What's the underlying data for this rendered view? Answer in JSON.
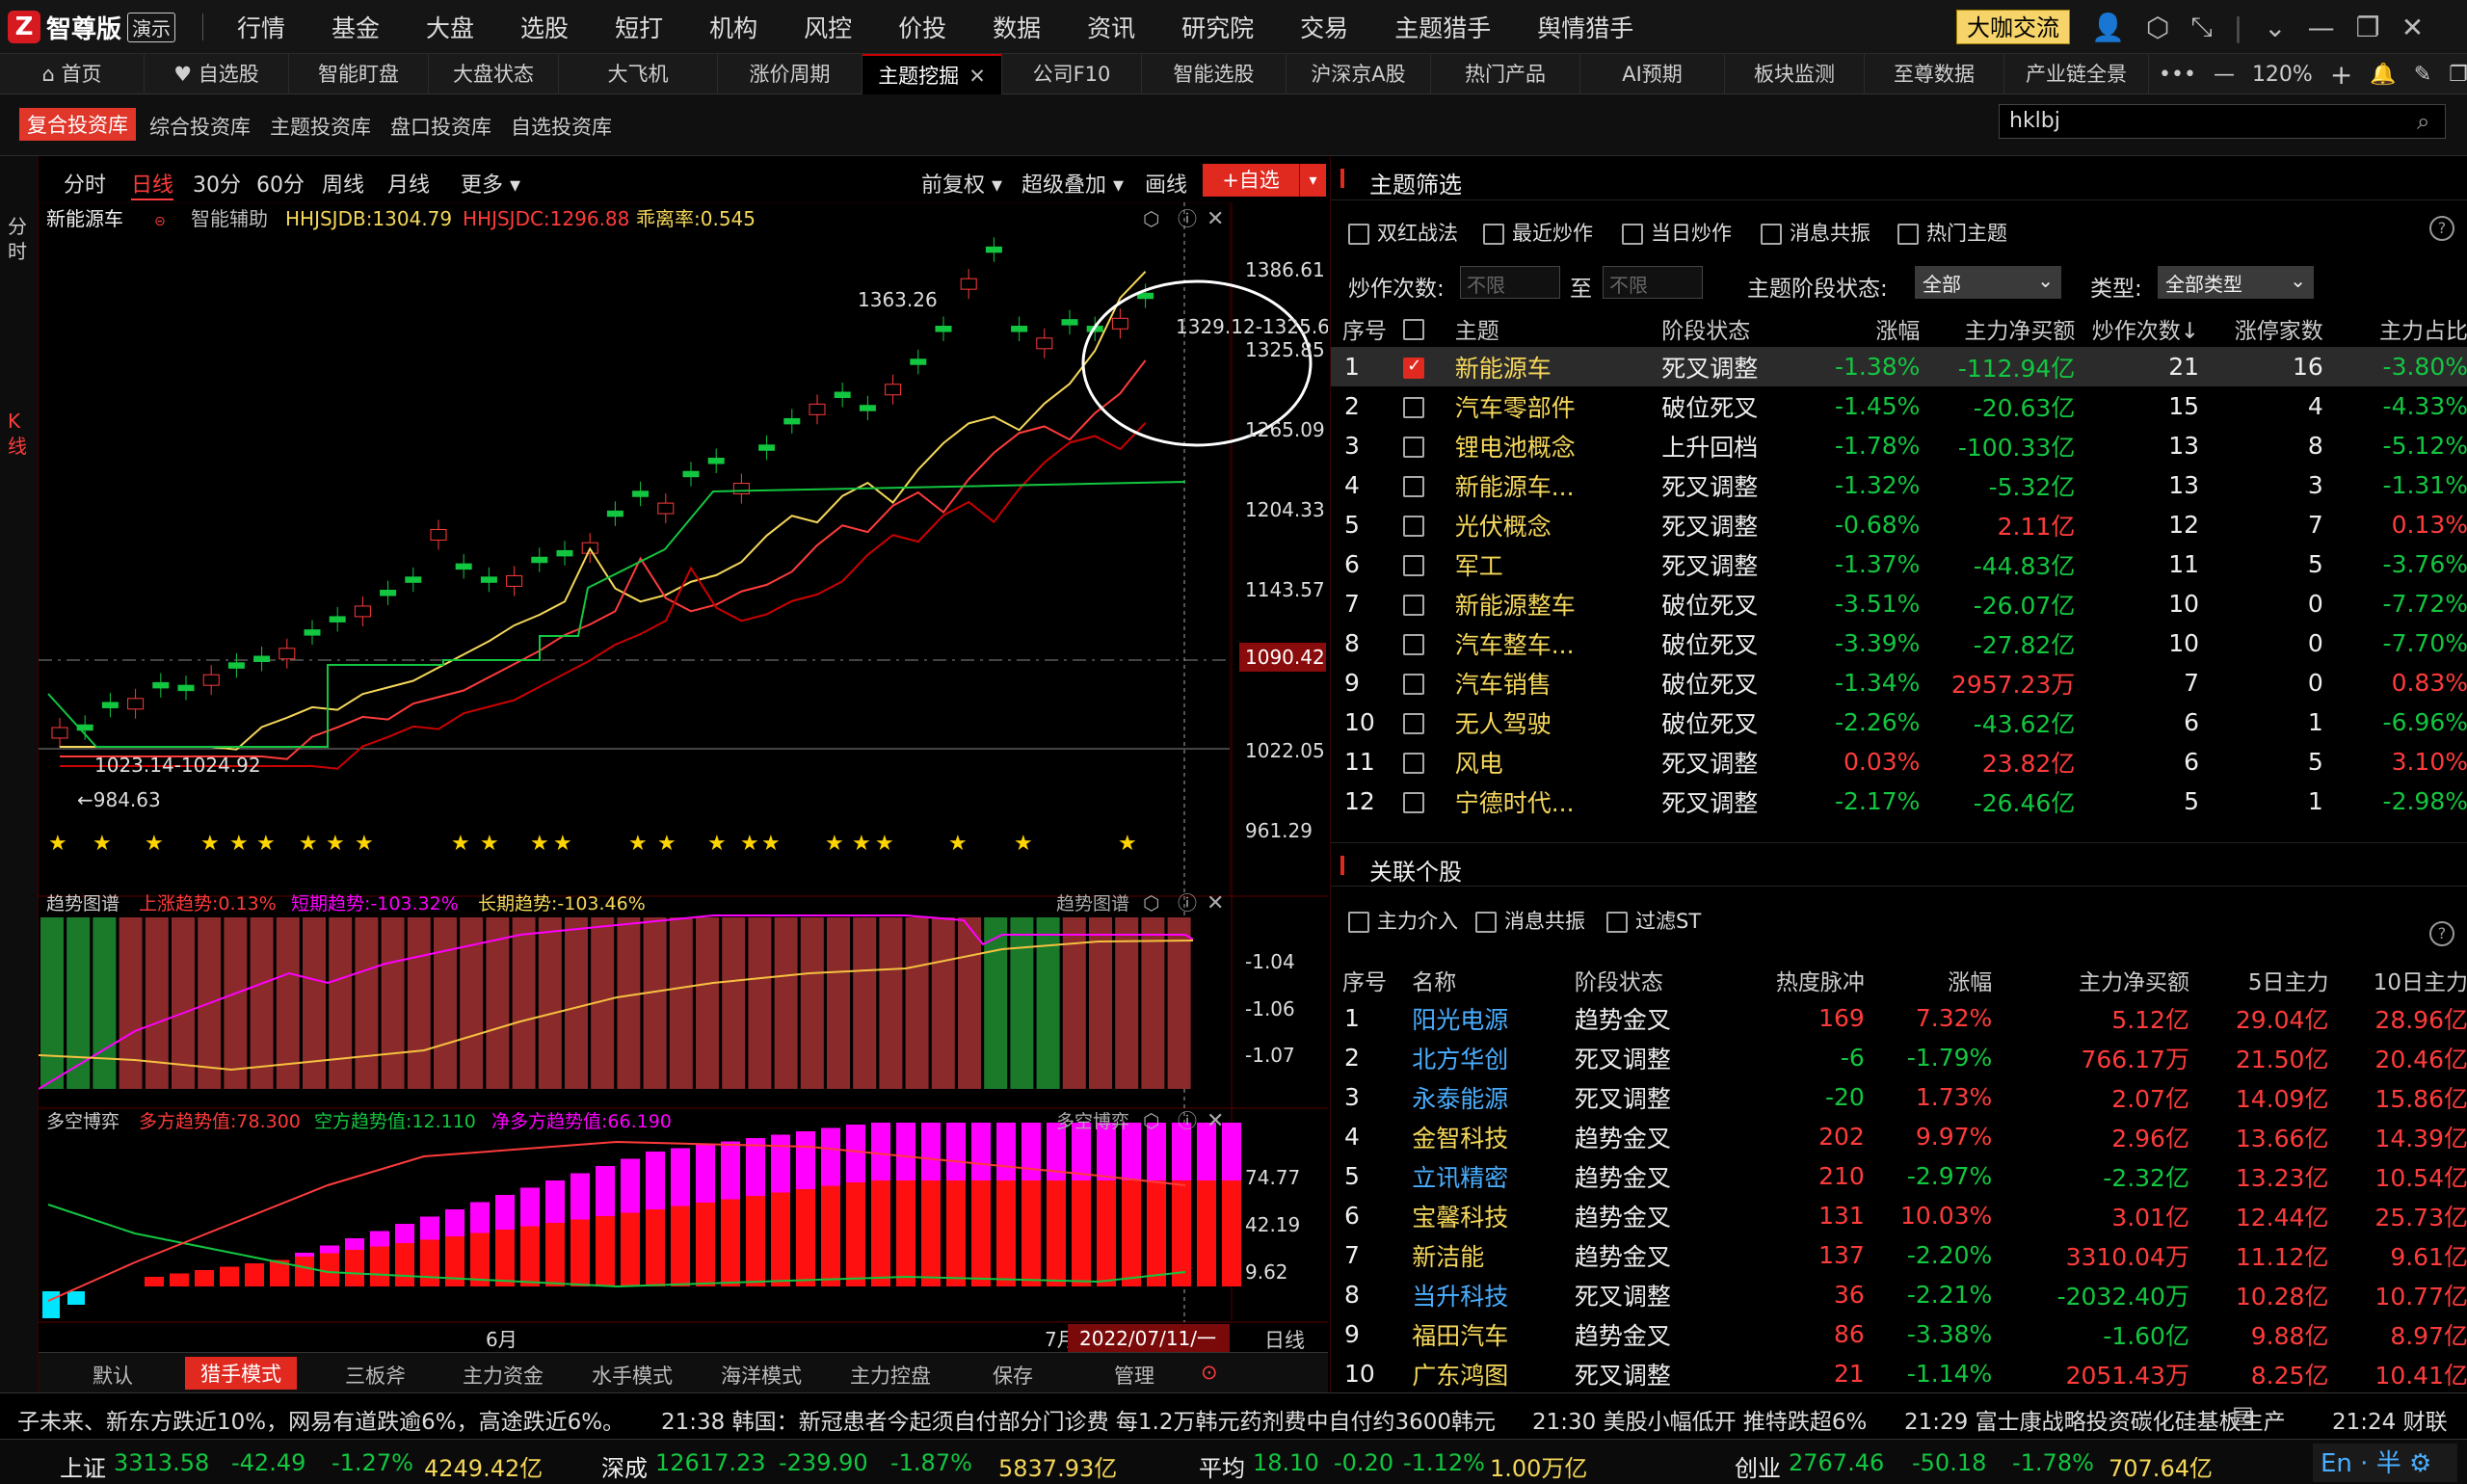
{
  "app": {
    "logo_mark": "Z",
    "name": "智尊版",
    "badge": "演示"
  },
  "menu": [
    "行情",
    "基金",
    "大盘",
    "选股",
    "短打",
    "机构",
    "风控",
    "价投",
    "数据",
    "资讯",
    "研究院",
    "交易",
    "主题猎手",
    "舆情猎手"
  ],
  "daka_button": "大咖交流",
  "window_icons": [
    "user-icon",
    "settings-icon",
    "shrink-icon",
    "minimize-icon",
    "restore-icon",
    "close-icon"
  ],
  "tabs": [
    "首页",
    "自选股",
    "智能盯盘",
    "大盘状态",
    "大飞机",
    "涨价周期",
    "主题挖掘",
    "公司F10",
    "智能选股",
    "沪深京A股",
    "热门产品",
    "AI预期",
    "板块监测",
    "至尊数据",
    "产业链全景"
  ],
  "active_tab": "主题挖掘",
  "tab_tools": {
    "more": "•••",
    "minus": "—",
    "zoom": "120%",
    "plus": "+"
  },
  "subnav": [
    "复合投资库",
    "综合投资库",
    "主题投资库",
    "盘口投资库",
    "自选投资库"
  ],
  "search_value": "hklbj",
  "left_rail": {
    "top": "分时",
    "bottom": "K线"
  },
  "periods": [
    "分时",
    "日线",
    "30分",
    "60分",
    "周线",
    "月线",
    "更多 ▾"
  ],
  "active_period": "日线",
  "chart_tools": {
    "fq": "前复权 ▾",
    "overlay": "超级叠加 ▾",
    "draw": "画线",
    "add": "+自选",
    "add_arrow": "▾"
  },
  "kline_header": {
    "name": "新能源车",
    "assist": "智能辅助",
    "hhjsjdb": "HHJSJDB:1304.79",
    "hhjsjdc": "HHJSJDC:1296.88",
    "ratio": "乖离率:0.545"
  },
  "price_axis": [
    "1386.61",
    "1325.85",
    "1265.09",
    "1204.33",
    "1143.57",
    "1090.42",
    "1022.05",
    "961.29"
  ],
  "annotations": {
    "high": "1363.26",
    "high2": "1329.12-1325.63",
    "low_range": "1023.14-1024.92",
    "low": "←984.63"
  },
  "trend_header": {
    "name": "趋势图谱",
    "up": "上涨趋势:0.13%",
    "short": "短期趋势:-103.32%",
    "long": "长期趋势:-103.46%",
    "label": "趋势图谱"
  },
  "trend_axis": [
    "-1.04",
    "-1.06",
    "-1.07"
  ],
  "duokong_header": {
    "name": "多空博弈",
    "bull": "多方趋势值:78.300",
    "bear": "空方趋势值:12.110",
    "net": "净多方趋势值:66.190",
    "label": "多空博弈"
  },
  "duokong_axis": [
    "74.77",
    "42.19",
    "9.62"
  ],
  "date_axis": {
    "m6": "6月",
    "m7": "7月",
    "cursor": "2022/07/11/一",
    "period": "日线"
  },
  "bottom_tabs": [
    "默认",
    "猎手模式",
    "三板斧",
    "主力资金",
    "水手模式",
    "海洋模式",
    "主力控盘",
    "保存",
    "管理"
  ],
  "active_bottom_tab": "猎手模式",
  "theme_filter": {
    "title": "主题筛选",
    "checks": [
      "双红战法",
      "最近炒作",
      "当日炒作",
      "消息共振",
      "热门主题"
    ],
    "count_label": "炒作次数:",
    "from_ph": "不限",
    "to": "至",
    "to_ph": "不限",
    "stage_label": "主题阶段状态:",
    "stage_value": "全部",
    "type_label": "类型:",
    "type_value": "全部类型",
    "columns": [
      "序号",
      "",
      "主题",
      "阶段状态",
      "涨幅",
      "主力净买额",
      "炒作次数↓",
      "涨停家数",
      "主力占比"
    ],
    "rows": [
      [
        "1",
        "新能源车",
        "死叉调整",
        "-1.38%",
        "-112.94亿",
        "21",
        "16",
        "-3.80%"
      ],
      [
        "2",
        "汽车零部件",
        "破位死叉",
        "-1.45%",
        "-20.63亿",
        "15",
        "4",
        "-4.33%"
      ],
      [
        "3",
        "锂电池概念",
        "上升回档",
        "-1.78%",
        "-100.33亿",
        "13",
        "8",
        "-5.12%"
      ],
      [
        "4",
        "新能源车...",
        "死叉调整",
        "-1.32%",
        "-5.32亿",
        "13",
        "3",
        "-1.31%"
      ],
      [
        "5",
        "光伏概念",
        "死叉调整",
        "-0.68%",
        "2.11亿",
        "12",
        "7",
        "0.13%"
      ],
      [
        "6",
        "军工",
        "死叉调整",
        "-1.37%",
        "-44.83亿",
        "11",
        "5",
        "-3.76%"
      ],
      [
        "7",
        "新能源整车",
        "破位死叉",
        "-3.51%",
        "-26.07亿",
        "10",
        "0",
        "-7.72%"
      ],
      [
        "8",
        "汽车整车...",
        "破位死叉",
        "-3.39%",
        "-27.82亿",
        "10",
        "0",
        "-7.70%"
      ],
      [
        "9",
        "汽车销售",
        "破位死叉",
        "-1.34%",
        "2957.23万",
        "7",
        "0",
        "0.83%"
      ],
      [
        "10",
        "无人驾驶",
        "破位死叉",
        "-2.26%",
        "-43.62亿",
        "6",
        "1",
        "-6.96%"
      ],
      [
        "11",
        "风电",
        "死叉调整",
        "0.03%",
        "23.82亿",
        "6",
        "5",
        "3.10%"
      ],
      [
        "12",
        "宁德时代...",
        "死叉调整",
        "-2.17%",
        "-26.46亿",
        "5",
        "1",
        "-2.98%"
      ]
    ]
  },
  "related": {
    "title": "关联个股",
    "checks": [
      "主力介入",
      "消息共振",
      "过滤ST"
    ],
    "columns": [
      "序号",
      "名称",
      "阶段状态",
      "热度脉冲",
      "涨幅",
      "主力净买额",
      "5日主力",
      "10日主力"
    ],
    "rows": [
      [
        "1",
        "阳光电源",
        "趋势金叉",
        "169",
        "7.32%",
        "5.12亿",
        "29.04亿",
        "28.96亿"
      ],
      [
        "2",
        "北方华创",
        "死叉调整",
        "-6",
        "-1.79%",
        "766.17万",
        "21.50亿",
        "20.46亿"
      ],
      [
        "3",
        "永泰能源",
        "死叉调整",
        "-20",
        "1.73%",
        "2.07亿",
        "14.09亿",
        "15.86亿"
      ],
      [
        "4",
        "金智科技",
        "趋势金叉",
        "202",
        "9.97%",
        "2.96亿",
        "13.66亿",
        "14.39亿"
      ],
      [
        "5",
        "立讯精密",
        "趋势金叉",
        "210",
        "-2.97%",
        "-2.32亿",
        "13.23亿",
        "10.54亿"
      ],
      [
        "6",
        "宝馨科技",
        "趋势金叉",
        "131",
        "10.03%",
        "3.01亿",
        "12.44亿",
        "25.73亿"
      ],
      [
        "7",
        "新洁能",
        "趋势金叉",
        "137",
        "-2.20%",
        "3310.04万",
        "11.12亿",
        "9.61亿"
      ],
      [
        "8",
        "当升科技",
        "死叉调整",
        "36",
        "-2.21%",
        "-2032.40万",
        "10.28亿",
        "10.77亿"
      ],
      [
        "9",
        "福田汽车",
        "趋势金叉",
        "86",
        "-3.38%",
        "-1.60亿",
        "9.88亿",
        "8.97亿"
      ],
      [
        "10",
        "广东鸿图",
        "死叉调整",
        "21",
        "-1.14%",
        "2051.43万",
        "8.25亿",
        "10.41亿"
      ]
    ]
  },
  "ticker": [
    "子未来、新东方跌近10%，网易有道跌逾6%，高途跌近6%。",
    "21:38 韩国：新冠患者今起须自付部分门诊费 每1.2万韩元药剂费中自付约3600韩元",
    "21:30 美股小幅低开 推特跌超6%",
    "21:29 富士康战略投资碳化硅基板生产",
    "21:24 财联"
  ],
  "indices": [
    {
      "name": "上证",
      "price": "3313.58",
      "chg": "-42.49",
      "pct": "-1.27%",
      "amt": "4249.42亿"
    },
    {
      "name": "深成",
      "price": "12617.23",
      "chg": "-239.90",
      "pct": "-1.87%",
      "amt": "5837.93亿"
    },
    {
      "name": "平均",
      "price": "18.10",
      "chg": "-0.20",
      "pct": "-1.12%",
      "amt": "1.00万亿"
    },
    {
      "name": "创业",
      "price": "2767.46",
      "chg": "-50.18",
      "pct": "-1.78%",
      "amt": "707.64亿"
    }
  ],
  "colors": {
    "up": "#ff3b3b",
    "down": "#13c640",
    "accent": "#e02a20",
    "yellow": "#f5d75a",
    "magenta": "#ff00ff"
  }
}
